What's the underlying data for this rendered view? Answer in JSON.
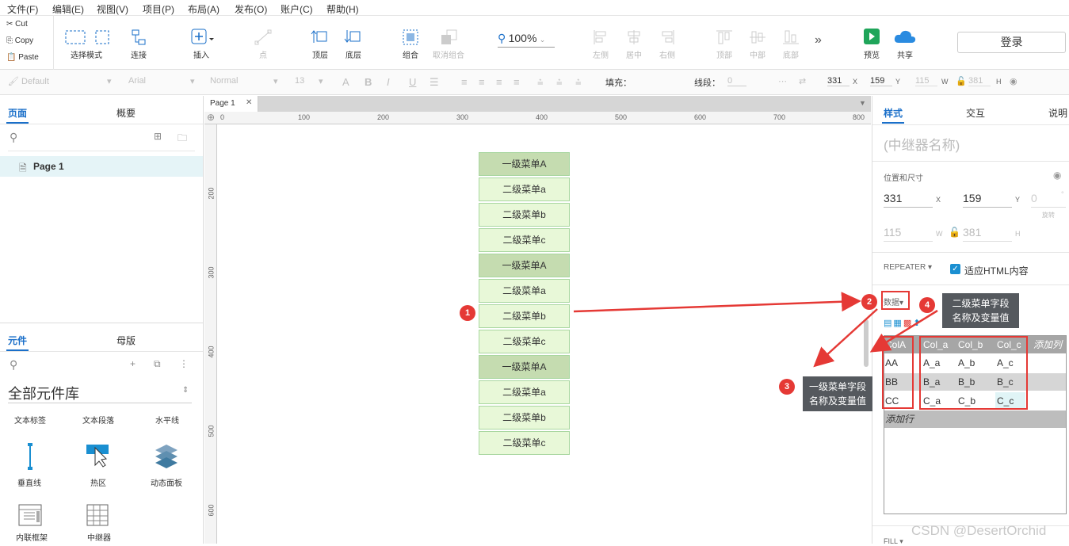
{
  "menu": [
    "文件(F)",
    "编辑(E)",
    "视图(V)",
    "项目(P)",
    "布局(A)",
    "发布(O)",
    "账户(C)",
    "帮助(H)"
  ],
  "clipboard": {
    "cut": "Cut",
    "copy": "Copy",
    "paste": "Paste"
  },
  "toolbar": {
    "select_mode": "选择模式",
    "connect": "连接",
    "insert": "插入",
    "point": "点",
    "top_layer": "顶层",
    "bottom_layer": "底层",
    "group": "组合",
    "ungroup": "取消组合",
    "zoom": "100%",
    "left": "左侧",
    "center": "居中",
    "right": "右侧",
    "top": "顶部",
    "middle": "中部",
    "bottom": "底部",
    "preview": "预览",
    "share": "共享",
    "login": "登录"
  },
  "format": {
    "style": "Default",
    "font": "Arial",
    "weight": "Normal",
    "size": "13",
    "fill_label": "填充：",
    "line_label": "线段：",
    "line_value": "0",
    "x": "331",
    "y": "159",
    "w": "115",
    "h": "381",
    "x_label": "X",
    "y_label": "Y",
    "w_label": "W",
    "h_label": "H"
  },
  "left": {
    "tab_pages": "页面",
    "tab_outline": "概要",
    "page1": "Page 1",
    "tab_widgets": "元件",
    "tab_masters": "母版",
    "library": "全部元件库",
    "widgets": [
      "文本标签",
      "文本段落",
      "水平线",
      "垂直线",
      "热区",
      "动态面板",
      "内联框架",
      "中继器"
    ]
  },
  "canvas": {
    "tab": "Page 1",
    "ruler_h": [
      "0",
      "100",
      "200",
      "300",
      "400",
      "500",
      "600",
      "700",
      "800"
    ],
    "ruler_v": [
      "200",
      "300",
      "400",
      "500",
      "600"
    ],
    "items": [
      {
        "text": "一级菜单A",
        "level": 1
      },
      {
        "text": "二级菜单a",
        "level": 2
      },
      {
        "text": "二级菜单b",
        "level": 2
      },
      {
        "text": "二级菜单c",
        "level": 2
      },
      {
        "text": "一级菜单A",
        "level": 1
      },
      {
        "text": "二级菜单a",
        "level": 2
      },
      {
        "text": "二级菜单b",
        "level": 2
      },
      {
        "text": "二级菜单c",
        "level": 2
      },
      {
        "text": "一级菜单A",
        "level": 1
      },
      {
        "text": "二级菜单a",
        "level": 2
      },
      {
        "text": "二级菜单b",
        "level": 2
      },
      {
        "text": "二级菜单c",
        "level": 2
      }
    ]
  },
  "right": {
    "tab_style": "样式",
    "tab_interact": "交互",
    "tab_notes": "说明",
    "name_placeholder": "(中继器名称)",
    "pos_size": "位置和尺寸",
    "x": "331",
    "y": "159",
    "rotation": "0",
    "rotation_label": "旋转",
    "w": "115",
    "h": "381",
    "x_label": "X",
    "y_label": "Y",
    "w_label": "W",
    "h_label": "H",
    "repeater": "REPEATER",
    "fit_html": "适应HTML内容",
    "data": "数据",
    "columns": [
      "ColA",
      "Col_a",
      "Col_b",
      "Col_c"
    ],
    "add_col": "添加列",
    "rows": [
      [
        "AA",
        "A_a",
        "A_b",
        "A_c"
      ],
      [
        "BB",
        "B_a",
        "B_b",
        "B_c"
      ],
      [
        "CC",
        "C_a",
        "C_b",
        "C_c"
      ]
    ],
    "add_row": "添加行",
    "fill": "FILL"
  },
  "annotations": {
    "b1": "1",
    "b2": "2",
    "b3": "3",
    "b4": "4",
    "tip3": [
      "一级菜单字段",
      "名称及变量值"
    ],
    "tip4": [
      "二级菜单字段",
      "名称及变量值"
    ]
  },
  "watermark": "CSDN @DesertOrchid",
  "colors": {
    "accent": "#1a6fc9",
    "badge": "#e53935",
    "menu_l1": "#c5dcb0",
    "menu_l2": "#e8f8d8"
  }
}
